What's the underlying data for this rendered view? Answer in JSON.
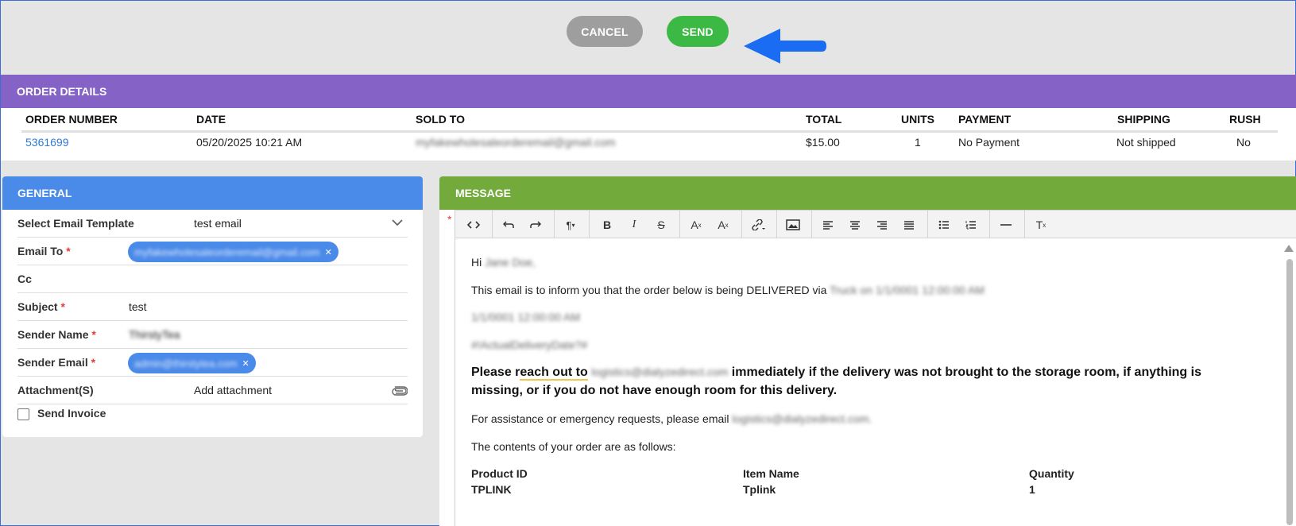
{
  "actions": {
    "cancel_label": "CANCEL",
    "send_label": "SEND"
  },
  "order": {
    "header": "ORDER DETAILS",
    "columns": [
      "ORDER NUMBER",
      "DATE",
      "SOLD TO",
      "TOTAL",
      "UNITS",
      "PAYMENT",
      "SHIPPING",
      "RUSH"
    ],
    "row": {
      "order_number": "5361699",
      "date": "05/20/2025 10:21 AM",
      "sold_to": "myfakewholesaleorderemail@gmail.com",
      "total": "$15.00",
      "units": "1",
      "payment": "No Payment",
      "shipping": "Not shipped",
      "rush": "No"
    }
  },
  "general": {
    "header": "GENERAL",
    "template_label": "Select Email Template",
    "template_value": "test email",
    "email_to_label": "Email To",
    "email_to_value": "myfakewholesaleorderemail@gmail.com",
    "cc_label": "Cc",
    "subject_label": "Subject",
    "subject_value": "test",
    "sender_name_label": "Sender Name",
    "sender_name_value": "ThirstyTea",
    "sender_email_label": "Sender Email",
    "sender_email_value": "admin@thirstytea.com",
    "attachment_label": "Attachment(S)",
    "attachment_placeholder": "Add attachment",
    "send_invoice_label": "Send Invoice",
    "required_mark": "*"
  },
  "message": {
    "header": "MESSAGE",
    "required_mark": "*",
    "greeting_prefix": "Hi",
    "greeting_name": "Jane Doe,",
    "inform_text": "This email is to inform you that the order below is being DELIVERED via",
    "inform_blur": "Truck on 1/1/0001 12:00:00 AM",
    "date_blur": "1/1/0001 12:00:00 AM",
    "placeholder_tag": "#!ActualDeliveryDate?#",
    "bold_prefix": "Please r",
    "bold_underlined": "each out to",
    "bold_email": "logistics@dialyzedirect.com",
    "bold_suffix": "immediately if the delivery was not brought to the storage room, if anything is missing, or if you do not have enough room for this delivery.",
    "assist_text": "For assistance or emergency requests, please email",
    "assist_email": "logistics@dialyzedirect.com.",
    "contents_text": "The contents of your order are as follows:",
    "table_headers": [
      "Product ID",
      "Item Name",
      "Quantity"
    ],
    "table_row": [
      "TPLINK",
      "Tplink",
      "1"
    ]
  },
  "toolbar_icons": [
    "code-view-icon",
    "undo-icon",
    "redo-icon",
    "paragraph-format-icon",
    "bold-icon",
    "italic-icon",
    "strikethrough-icon",
    "superscript-icon",
    "subscript-icon",
    "link-icon",
    "image-icon",
    "align-left-icon",
    "align-center-icon",
    "align-right-icon",
    "align-justify-icon",
    "bulleted-list-icon",
    "numbered-list-icon",
    "horizontal-line-icon",
    "clear-formatting-icon"
  ],
  "colors": {
    "order_header": "#8562c5",
    "general_header": "#4a8ae8",
    "message_header": "#72ab3c",
    "send": "#3cb944",
    "cancel": "#9e9e9e",
    "arrow": "#1a6df2"
  }
}
